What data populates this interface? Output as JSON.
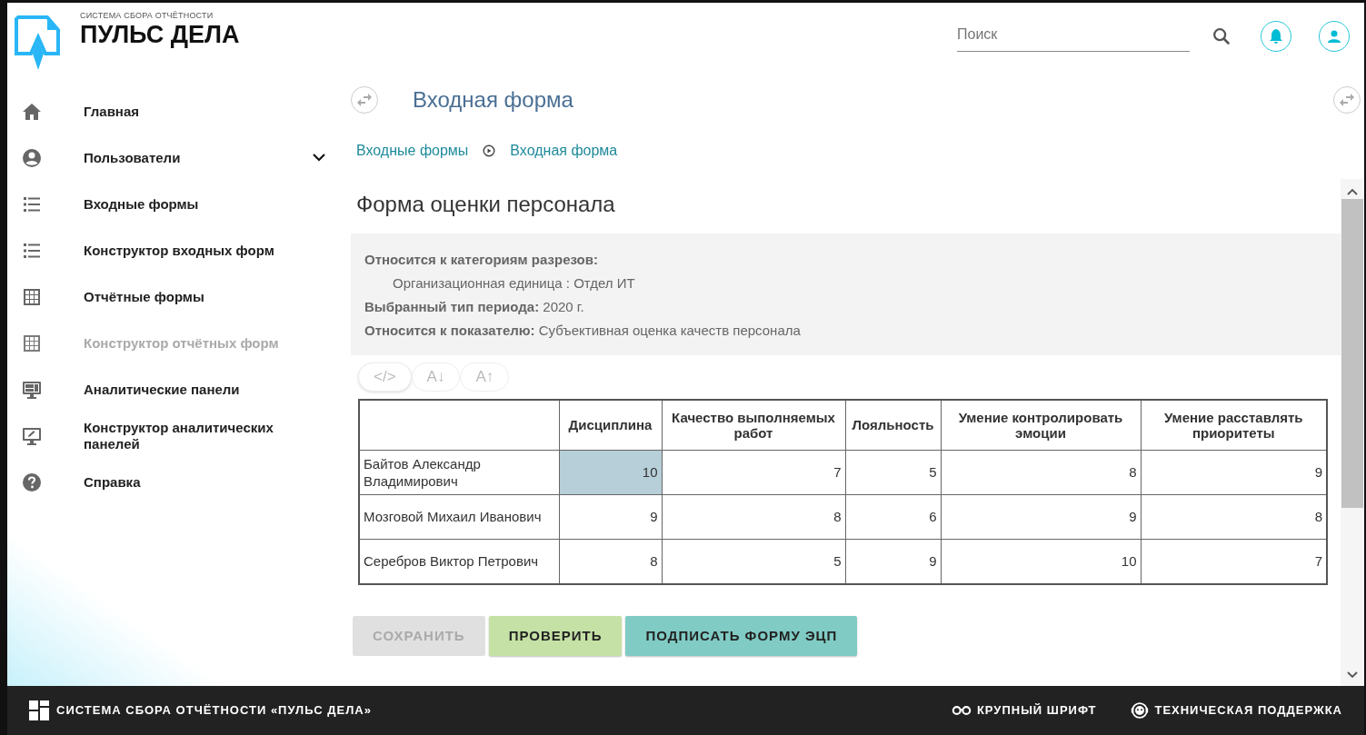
{
  "header": {
    "logo_caption": "СИСТЕМА СБОРА ОТЧЁТНОСТИ",
    "logo_title": "ПУЛЬС ДЕЛА",
    "search": {
      "placeholder": "Поиск"
    }
  },
  "sidebar": {
    "items": [
      {
        "label": "Главная",
        "kind": "link",
        "disabled": false
      },
      {
        "label": "Пользователи",
        "kind": "group",
        "disabled": false
      },
      {
        "label": "Входные формы",
        "kind": "link",
        "disabled": false
      },
      {
        "label": "Конструктор входных форм",
        "kind": "link",
        "disabled": false
      },
      {
        "label": "Отчётные формы",
        "kind": "link",
        "disabled": false
      },
      {
        "label": "Конструктор отчётных форм",
        "kind": "link",
        "disabled": true
      },
      {
        "label": "Аналитические панели",
        "kind": "link",
        "disabled": false
      },
      {
        "label": "Конструктор аналитических панелей",
        "kind": "link",
        "disabled": false
      },
      {
        "label": "Справка",
        "kind": "link",
        "disabled": false
      }
    ]
  },
  "page_title": "Входная форма",
  "breadcrumbs": [
    "Входные формы",
    "Входная форма"
  ],
  "form": {
    "title": "Форма оценки персонала",
    "info": [
      {
        "label": "Относится к категориям разрезов:",
        "kind": "heading"
      },
      {
        "value": "Организационная единица : Отдел ИТ",
        "kind": "indent"
      },
      {
        "label": "Выбранный тип периода:",
        "value": "2020 г.",
        "kind": "pair"
      },
      {
        "label": "Относится к показателю:",
        "value": "Субъективная оценка качеств персонала",
        "kind": "pair"
      }
    ],
    "toolbar": [
      "</>",
      "A↓",
      "A↑"
    ],
    "table": {
      "columns": [
        "",
        "Дисциплина",
        "Качество выполняемых работ",
        "Лояльность",
        "Умение контролировать эмоции",
        "Умение расставлять приоритеты"
      ],
      "rows": [
        {
          "cells": [
            {
              "value": "Байтов Александр Владимирович",
              "selected": false
            },
            {
              "value": "10",
              "selected": true
            },
            {
              "value": "7",
              "selected": false
            },
            {
              "value": "5",
              "selected": false
            },
            {
              "value": "8",
              "selected": false
            },
            {
              "value": "9",
              "selected": false
            }
          ]
        },
        {
          "cells": [
            {
              "value": "Мозговой Михаил Иванович",
              "selected": false
            },
            {
              "value": "9",
              "selected": false
            },
            {
              "value": "8",
              "selected": false
            },
            {
              "value": "6",
              "selected": false
            },
            {
              "value": "9",
              "selected": false
            },
            {
              "value": "8",
              "selected": false
            }
          ]
        },
        {
          "cells": [
            {
              "value": "Серебров Виктор Петрович",
              "selected": false
            },
            {
              "value": "8",
              "selected": false
            },
            {
              "value": "5",
              "selected": false
            },
            {
              "value": "9",
              "selected": false
            },
            {
              "value": "10",
              "selected": false
            },
            {
              "value": "7",
              "selected": false
            }
          ]
        }
      ]
    },
    "buttons": [
      {
        "label": "СОХРАНИТЬ",
        "kind": "save",
        "disabled": true
      },
      {
        "label": "ПРОВЕРИТЬ",
        "kind": "check",
        "disabled": false
      },
      {
        "label": "ПОДПИСАТЬ ФОРМУ ЭЦП",
        "kind": "sign",
        "disabled": false
      }
    ]
  },
  "footer": {
    "title": "СИСТЕМА СБОРА ОТЧЁТНОСТИ «ПУЛЬС ДЕЛА»",
    "links": [
      "КРУПНЫЙ ШРИФТ",
      "ТЕХНИЧЕСКАЯ ПОДДЕРЖКА"
    ]
  }
}
